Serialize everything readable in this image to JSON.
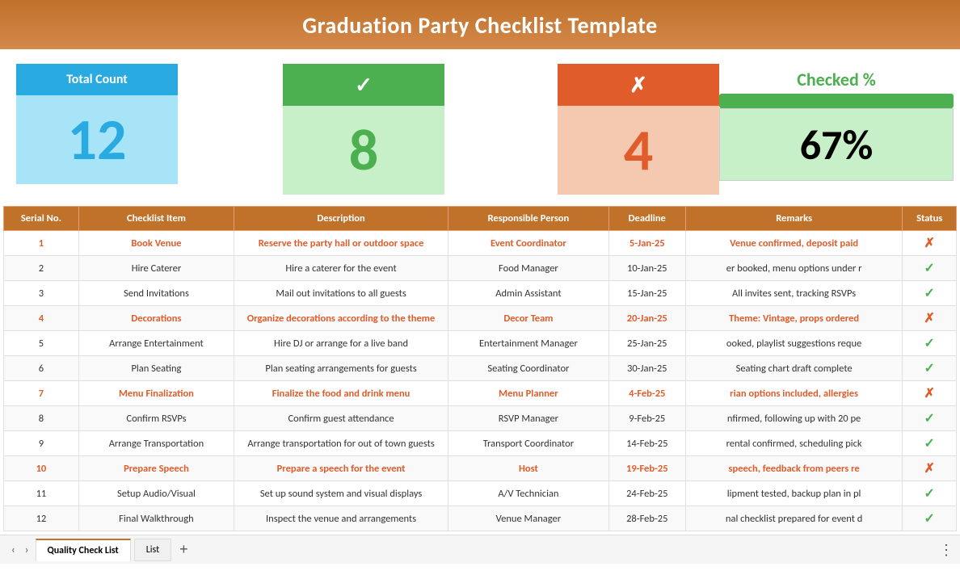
{
  "header": {
    "title": "Graduation Party Checklist Template"
  },
  "stats": {
    "total_count_label": "Total Count",
    "total_count_value": "12",
    "checked_label": "✓",
    "checked_value": "8",
    "unchecked_label": "✗",
    "unchecked_value": "4",
    "percent_label": "Checked %",
    "percent_value": "67%",
    "percent_number": 67
  },
  "table": {
    "headers": [
      "Serial No.",
      "Checklist Item",
      "Description",
      "Responsible Person",
      "Deadline",
      "Remarks",
      "Status"
    ],
    "rows": [
      {
        "serial": "1",
        "item": "Book Venue",
        "description": "Reserve the party hall or outdoor space",
        "person": "Event Coordinator",
        "deadline": "5-Jan-25",
        "remarks": "Venue confirmed, deposit paid",
        "status": "x",
        "highlight": true
      },
      {
        "serial": "2",
        "item": "Hire Caterer",
        "description": "Hire a caterer for the event",
        "person": "Food Manager",
        "deadline": "10-Jan-25",
        "remarks": "er booked, menu options under r",
        "status": "check",
        "highlight": false
      },
      {
        "serial": "3",
        "item": "Send Invitations",
        "description": "Mail out invitations to all guests",
        "person": "Admin Assistant",
        "deadline": "15-Jan-25",
        "remarks": "All invites sent, tracking RSVPs",
        "status": "check",
        "highlight": false
      },
      {
        "serial": "4",
        "item": "Decorations",
        "description": "Organize decorations according to the theme",
        "person": "Decor Team",
        "deadline": "20-Jan-25",
        "remarks": "Theme: Vintage, props ordered",
        "status": "x",
        "highlight": true
      },
      {
        "serial": "5",
        "item": "Arrange Entertainment",
        "description": "Hire DJ or arrange for a live band",
        "person": "Entertainment Manager",
        "deadline": "25-Jan-25",
        "remarks": "ooked, playlist suggestions reque",
        "status": "check",
        "highlight": false
      },
      {
        "serial": "6",
        "item": "Plan Seating",
        "description": "Plan seating arrangements for guests",
        "person": "Seating Coordinator",
        "deadline": "30-Jan-25",
        "remarks": "Seating chart draft complete",
        "status": "check",
        "highlight": false
      },
      {
        "serial": "7",
        "item": "Menu Finalization",
        "description": "Finalize the food and drink menu",
        "person": "Menu Planner",
        "deadline": "4-Feb-25",
        "remarks": "rian options included, allergies",
        "status": "x",
        "highlight": true
      },
      {
        "serial": "8",
        "item": "Confirm RSVPs",
        "description": "Confirm guest attendance",
        "person": "RSVP Manager",
        "deadline": "9-Feb-25",
        "remarks": "nfirmed, following up with 20 pe",
        "status": "check",
        "highlight": false
      },
      {
        "serial": "9",
        "item": "Arrange Transportation",
        "description": "Arrange transportation for out of town guests",
        "person": "Transport Coordinator",
        "deadline": "14-Feb-25",
        "remarks": "rental confirmed, scheduling pick",
        "status": "check",
        "highlight": false
      },
      {
        "serial": "10",
        "item": "Prepare Speech",
        "description": "Prepare a speech for the event",
        "person": "Host",
        "deadline": "19-Feb-25",
        "remarks": "speech, feedback from peers re",
        "status": "x",
        "highlight": true
      },
      {
        "serial": "11",
        "item": "Setup Audio/Visual",
        "description": "Set up sound system and visual displays",
        "person": "A/V Technician",
        "deadline": "24-Feb-25",
        "remarks": "lipment tested, backup plan in pl",
        "status": "check",
        "highlight": false
      },
      {
        "serial": "12",
        "item": "Final Walkthrough",
        "description": "Inspect the venue and arrangements",
        "person": "Venue Manager",
        "deadline": "28-Feb-25",
        "remarks": "nal checklist prepared for event d",
        "status": "check",
        "highlight": false
      }
    ]
  },
  "tabs": {
    "active": "Quality Check List",
    "inactive": "List",
    "add_label": "+",
    "nav_prev": "‹",
    "nav_next": "›",
    "more_icon": "⋮"
  }
}
